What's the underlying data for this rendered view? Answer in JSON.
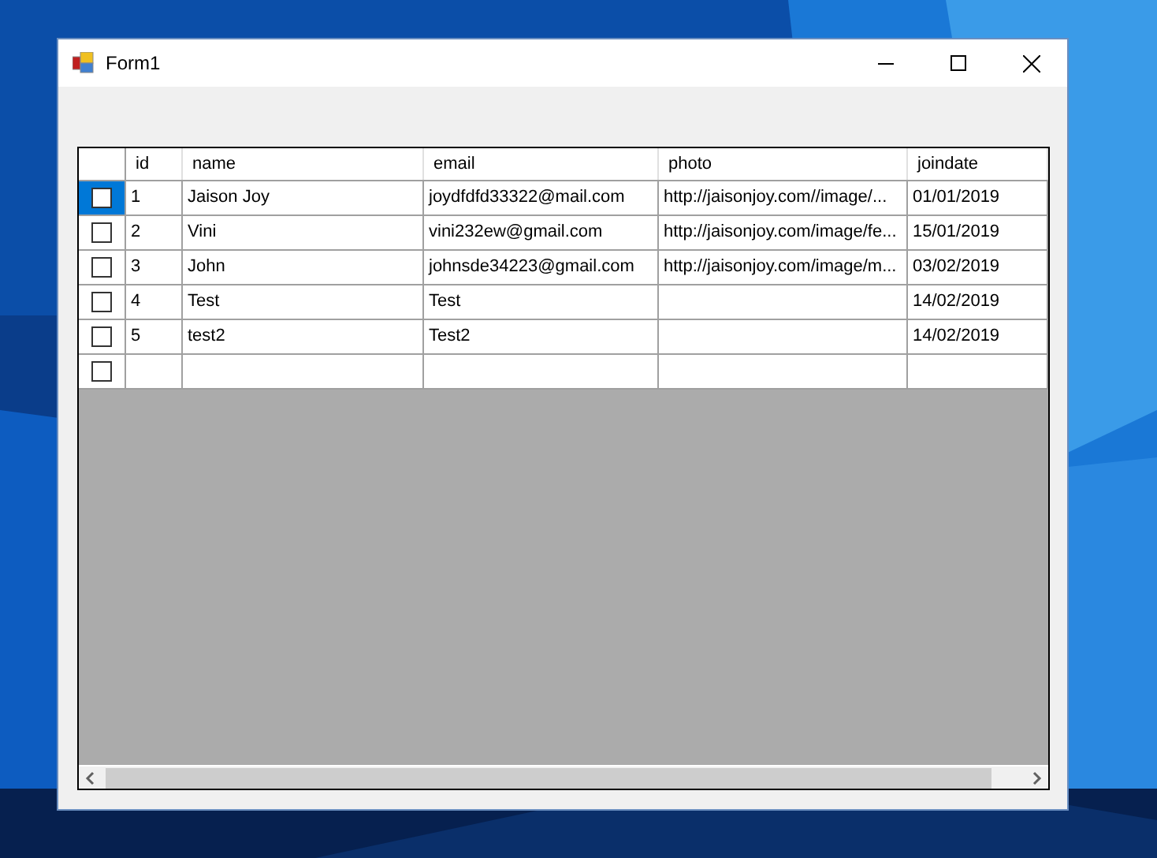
{
  "window": {
    "title": "Form1"
  },
  "grid": {
    "columns": [
      "id",
      "name",
      "email",
      "photo",
      "joindate"
    ],
    "rows": [
      {
        "selected": true,
        "checked": false,
        "cells": [
          "1",
          "Jaison Joy",
          "joydfdfd33322@mail.com",
          "http://jaisonjoy.com//image/...",
          "01/01/2019"
        ]
      },
      {
        "selected": false,
        "checked": false,
        "cells": [
          "2",
          "Vini",
          "vini232ew@gmail.com",
          "http://jaisonjoy.com/image/fe...",
          "15/01/2019"
        ]
      },
      {
        "selected": false,
        "checked": false,
        "cells": [
          "3",
          "John",
          "johnsde34223@gmail.com",
          "http://jaisonjoy.com/image/m...",
          "03/02/2019"
        ]
      },
      {
        "selected": false,
        "checked": false,
        "cells": [
          "4",
          "Test",
          "Test",
          "",
          "14/02/2019"
        ]
      },
      {
        "selected": false,
        "checked": false,
        "cells": [
          "5",
          "test2",
          "Test2",
          "",
          "14/02/2019"
        ]
      },
      {
        "selected": false,
        "checked": false,
        "cells": [
          "",
          "",
          "",
          "",
          ""
        ]
      }
    ]
  }
}
